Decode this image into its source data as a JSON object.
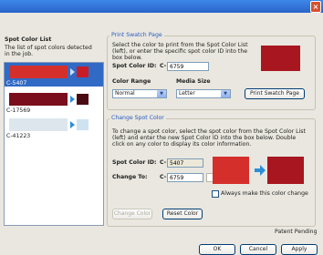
{
  "window": {
    "close_symbol": "×"
  },
  "left_panel": {
    "title": "Spot Color List",
    "description": "The list of spot colors detected in the job.",
    "items": [
      {
        "label": "C-5407",
        "color": "#d52f2b",
        "mini_color": "#c81d27"
      },
      {
        "label": "C-17569",
        "color": "#7a0e1c",
        "mini_color": "#4a0a14"
      },
      {
        "label": "C-41223",
        "color": "#dde6ec",
        "mini_color": "#cfe2f0"
      }
    ]
  },
  "print_swatch": {
    "legend": "Print Swatch Page",
    "instructions": "Select the color to print from the Spot Color List (left), or enter the specific spot color ID into the box below.",
    "spot_color_id_label": "Spot Color ID:",
    "prefix": "C-",
    "spot_color_id_value": "6759",
    "preview_color": "#a8161f",
    "color_range_label": "Color Range",
    "color_range_value": "Normal",
    "media_size_label": "Media Size",
    "media_size_value": "Letter",
    "print_button": "Print Swatch Page"
  },
  "change_spot": {
    "legend": "Change Spot Color",
    "instructions": "To change a spot color, select the spot color from the Spot Color List (left) and enter the new Spot Color ID into the box below. Double click on any color to display its color information.",
    "spot_color_id_label": "Spot Color ID:",
    "prefix": "C-",
    "spot_color_id_value": "5407",
    "change_to_label": "Change To:",
    "change_to_value": "6759",
    "from_color": "#d52f2b",
    "to_color": "#a8161f",
    "always_label": "Always make this color change",
    "always_checked": false,
    "change_button": "Change Color",
    "reset_button": "Reset Color"
  },
  "footer": {
    "patent": "Patent Pending",
    "ok": "OK",
    "cancel": "Cancel",
    "apply": "Apply"
  }
}
